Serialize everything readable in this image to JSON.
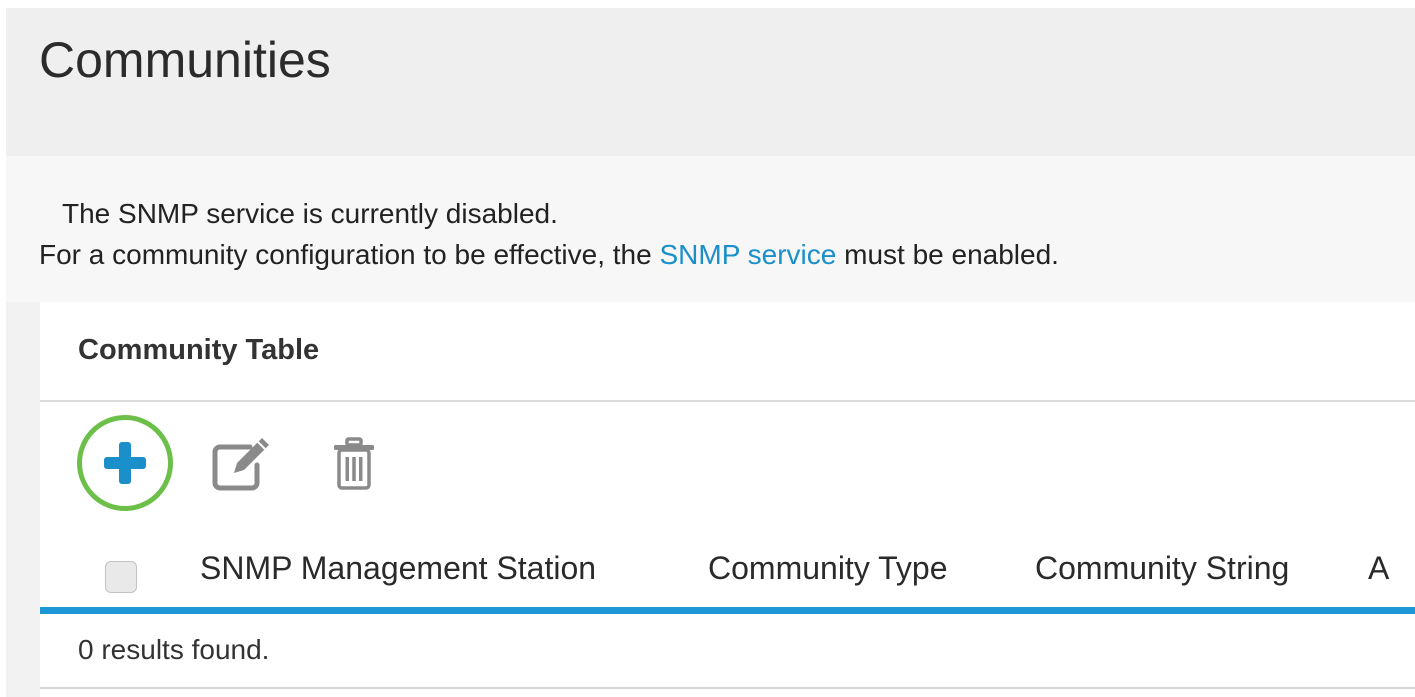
{
  "page": {
    "title": "Communities"
  },
  "notice": {
    "line1": "The SNMP service is currently disabled.",
    "line2_prefix": "For a community configuration to be effective, the ",
    "line2_link": "SNMP service",
    "line2_suffix": " must be enabled."
  },
  "table": {
    "title": "Community Table",
    "toolbar": {
      "add_icon": "plus-icon",
      "edit_icon": "edit-icon",
      "delete_icon": "trash-icon"
    },
    "columns": [
      "SNMP Management Station",
      "Community Type",
      "Community String",
      "A"
    ],
    "rows": [],
    "results_text": "0 results found."
  },
  "colors": {
    "accent_blue": "#1b98d5",
    "link_blue": "#1a8fc9",
    "highlight_green": "#6cc04a",
    "icon_gray": "#8a8a8a"
  }
}
